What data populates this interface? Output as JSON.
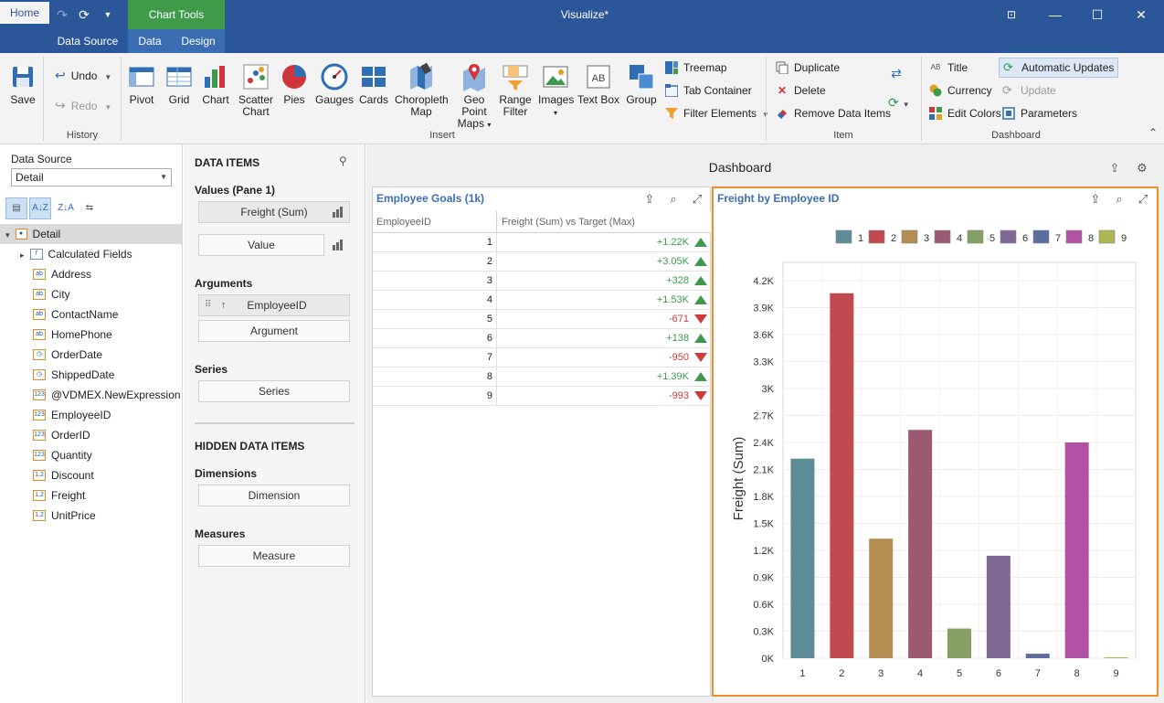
{
  "window": {
    "title": "Visualize*",
    "contextual_group": "Chart Tools",
    "app_icon": "VDM"
  },
  "tabs": [
    "Home",
    "Data Source",
    "Data",
    "Design"
  ],
  "ribbon": {
    "save": "Save",
    "undo": "Undo",
    "redo": "Redo",
    "history_group": "History",
    "insert_group": "Insert",
    "item_group": "Item",
    "dashboard_group": "Dashboard",
    "insert_items": [
      {
        "label": "Pivot",
        "icon": "pivot-icon"
      },
      {
        "label": "Grid",
        "icon": "grid-icon"
      },
      {
        "label": "Chart",
        "icon": "chart-icon"
      },
      {
        "label": "Scatter\nChart",
        "icon": "scatter-chart-icon"
      },
      {
        "label": "Pies",
        "icon": "pie-icon"
      },
      {
        "label": "Gauges",
        "icon": "gauge-icon"
      },
      {
        "label": "Cards",
        "icon": "cards-icon"
      },
      {
        "label": "Choropleth\nMap",
        "icon": "choropleth-map-icon"
      },
      {
        "label": "Geo Point\nMaps",
        "icon": "geo-point-map-icon"
      },
      {
        "label": "Range\nFilter",
        "icon": "range-filter-icon"
      },
      {
        "label": "Images",
        "icon": "images-icon"
      },
      {
        "label": "Text Box",
        "icon": "text-box-icon"
      },
      {
        "label": "Group",
        "icon": "group-icon"
      }
    ],
    "treemap": "Treemap",
    "tab_container": "Tab Container",
    "filter_elements": "Filter Elements",
    "duplicate": "Duplicate",
    "delete": "Delete",
    "remove_data_items": "Remove Data Items",
    "title": "Title",
    "currency": "Currency",
    "edit_colors": "Edit Colors",
    "automatic_updates": "Automatic Updates",
    "update": "Update",
    "parameters": "Parameters"
  },
  "left_panel": {
    "data_source_label": "Data Source",
    "data_source_value": "Detail",
    "tree_root": "Detail",
    "fields": [
      {
        "label": "Calculated Fields",
        "icon": "function-icon",
        "glyph": "f"
      },
      {
        "label": "Address",
        "icon": "text-field-icon",
        "glyph": "ab"
      },
      {
        "label": "City",
        "icon": "text-field-icon",
        "glyph": "ab"
      },
      {
        "label": "ContactName",
        "icon": "text-field-icon",
        "glyph": "ab"
      },
      {
        "label": "HomePhone",
        "icon": "text-field-icon",
        "glyph": "ab"
      },
      {
        "label": "OrderDate",
        "icon": "date-field-icon",
        "glyph": "◷"
      },
      {
        "label": "ShippedDate",
        "icon": "date-field-icon",
        "glyph": "◷"
      },
      {
        "label": "@VDMEX.NewExpression",
        "icon": "integer-field-icon",
        "glyph": "123"
      },
      {
        "label": "EmployeeID",
        "icon": "integer-field-icon",
        "glyph": "123"
      },
      {
        "label": "OrderID",
        "icon": "integer-field-icon",
        "glyph": "123"
      },
      {
        "label": "Quantity",
        "icon": "integer-field-icon",
        "glyph": "123"
      },
      {
        "label": "Discount",
        "icon": "decimal-field-icon",
        "glyph": "1,2"
      },
      {
        "label": "Freight",
        "icon": "decimal-field-icon",
        "glyph": "1,2"
      },
      {
        "label": "UnitPrice",
        "icon": "decimal-field-icon",
        "glyph": "1,2"
      }
    ]
  },
  "items_panel": {
    "data_items": "DATA ITEMS",
    "values_label": "Values (Pane 1)",
    "value_freight": "Freight (Sum)",
    "value_placeholder": "Value",
    "arguments_label": "Arguments",
    "argument_employee": "EmployeeID",
    "argument_placeholder": "Argument",
    "series_label": "Series",
    "series_placeholder": "Series",
    "hidden_items": "HIDDEN DATA ITEMS",
    "dimensions_label": "Dimensions",
    "dimension_placeholder": "Dimension",
    "measures_label": "Measures",
    "measure_placeholder": "Measure"
  },
  "dashboard": {
    "title": "Dashboard",
    "grid": {
      "title": "Employee Goals (1k)",
      "columns": [
        "EmployeeID",
        "Freight (Sum) vs Target (Max)"
      ],
      "rows": [
        {
          "id": "1",
          "delta": "+1.22K",
          "trend": "up"
        },
        {
          "id": "2",
          "delta": "+3.05K",
          "trend": "up"
        },
        {
          "id": "3",
          "delta": "+328",
          "trend": "up"
        },
        {
          "id": "4",
          "delta": "+1.53K",
          "trend": "up"
        },
        {
          "id": "5",
          "delta": "-671",
          "trend": "down"
        },
        {
          "id": "6",
          "delta": "+138",
          "trend": "up"
        },
        {
          "id": "7",
          "delta": "-950",
          "trend": "down"
        },
        {
          "id": "8",
          "delta": "+1.39K",
          "trend": "up"
        },
        {
          "id": "9",
          "delta": "-993",
          "trend": "down"
        }
      ]
    },
    "chart_title": "Freight by Employee ID"
  },
  "chart_data": {
    "type": "bar",
    "title": "Freight by Employee ID",
    "ylabel": "Freight (Sum)",
    "xlabel": "",
    "categories": [
      "1",
      "2",
      "3",
      "4",
      "5",
      "6",
      "7",
      "8",
      "9"
    ],
    "values": [
      2220,
      4060,
      1330,
      2540,
      330,
      1140,
      50,
      2400,
      10
    ],
    "colors": [
      "#5e8c96",
      "#c14a50",
      "#b38d52",
      "#9c5a72",
      "#84a064",
      "#806894",
      "#5c6e9e",
      "#b152a4",
      "#aeb654"
    ],
    "yticks": [
      "0K",
      "0.3K",
      "0.6K",
      "0.9K",
      "1.2K",
      "1.5K",
      "1.8K",
      "2.1K",
      "2.4K",
      "2.7K",
      "3K",
      "3.3K",
      "3.6K",
      "3.9K",
      "4.2K"
    ],
    "ylim": [
      0,
      4200
    ],
    "legend": [
      "1",
      "2",
      "3",
      "4",
      "5",
      "6",
      "7",
      "8",
      "9"
    ],
    "legend_position": "top-right",
    "grid": true
  }
}
